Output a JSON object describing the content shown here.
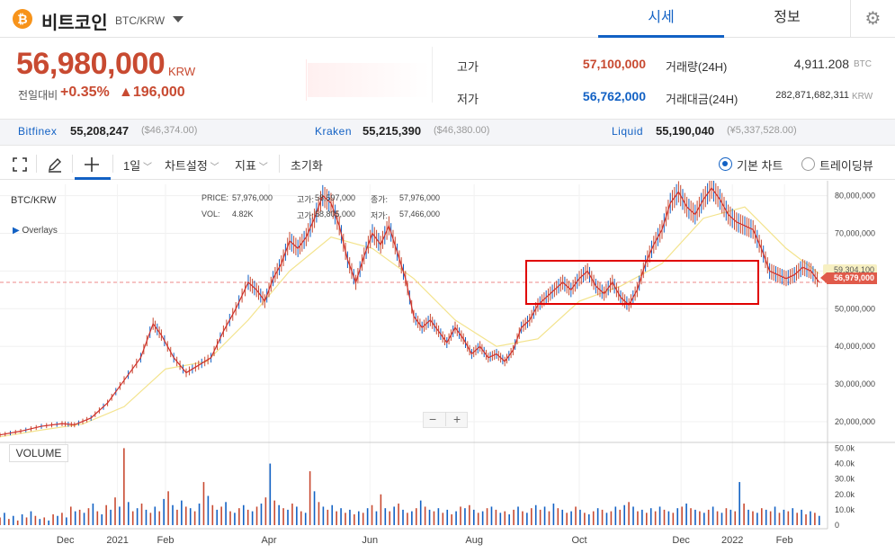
{
  "header": {
    "coin_icon": "₿",
    "coin_name": "비트코인",
    "pair": "BTC/KRW",
    "tab_price": "시세",
    "tab_info": "정보",
    "gear_icon": "⚙"
  },
  "ticker": {
    "price": "56,980,000",
    "unit": "KRW",
    "change_label": "전일대비",
    "change_pct": "+0.35%",
    "change_amt": "▲196,000"
  },
  "stats": {
    "high_label": "고가",
    "high": "57,100,000",
    "low_label": "저가",
    "low": "56,762,000",
    "vol_label": "거래량(24H)",
    "vol": "4,911.208",
    "vol_unit": "BTC",
    "amt_label": "거래대금(24H)",
    "amt": "282,871,682,311",
    "amt_unit": "KRW"
  },
  "exchanges": [
    {
      "name": "Bitfinex",
      "price": "55,208,247",
      "sub": "($46,374.00)"
    },
    {
      "name": "Kraken",
      "price": "55,215,390",
      "sub": "($46,380.00)"
    },
    {
      "name": "Liquid",
      "price": "55,190,040",
      "sub": "(¥5,337,528.00)"
    }
  ],
  "toolbar": {
    "interval": "1일",
    "chart_settings": "차트설정",
    "indicator": "지표",
    "reset": "초기화",
    "basic_chart": "기본 차트",
    "tradingview": "트레이딩뷰"
  },
  "chart_legend": {
    "symbol": "BTC/KRW",
    "overlays": "Overlays",
    "price_label": "PRICE:",
    "price": "57,976,000",
    "vol_label": "VOL:",
    "vol": "4.82K",
    "high_label": "고가:",
    "high": "58,597,000",
    "low_label": "고가:",
    "low": "58,805,000",
    "close_label": "종가:",
    "close": "57,976,000",
    "lowp_label": "저가:",
    "lowp": "57,466,000",
    "last_price_tag": "56,979,000",
    "ma_tag": "59,304,100",
    "volume_button": "VOLUME",
    "zoom_out": "−",
    "zoom_in": "+"
  },
  "chart_data": {
    "type": "line",
    "title": "",
    "x_ticks": [
      "Dec",
      "2021",
      "Feb",
      "Apr",
      "Jun",
      "Aug",
      "Oct",
      "Dec",
      "2022",
      "Feb"
    ],
    "y_ticks": [
      "80,000,000",
      "70,000,000",
      "60,000,000",
      "50,000,000",
      "40,000,000",
      "30,000,000",
      "20,000,000"
    ],
    "y_ticks_values": [
      80000000,
      70000000,
      60000000,
      50000000,
      40000000,
      30000000,
      20000000
    ],
    "ylim": [
      15000000,
      83000000
    ],
    "volume_ticks": [
      "50.0k",
      "40.0k",
      "30.0k",
      "20.0k",
      "10.0k",
      "0"
    ],
    "volume_ylim": [
      0,
      52000
    ],
    "series": [
      {
        "values": [
          [
            0,
            16.5
          ],
          [
            5,
            17.5
          ],
          [
            10,
            18.8
          ],
          [
            15,
            19.5
          ],
          [
            18,
            19.2
          ],
          [
            22,
            21
          ],
          [
            26,
            25
          ],
          [
            30,
            31
          ],
          [
            34,
            37
          ],
          [
            37,
            46
          ],
          [
            39,
            43
          ],
          [
            42,
            37
          ],
          [
            45,
            33
          ],
          [
            48,
            35
          ],
          [
            51,
            37
          ],
          [
            54,
            44
          ],
          [
            57,
            50
          ],
          [
            60,
            57
          ],
          [
            62,
            55
          ],
          [
            64,
            52
          ],
          [
            66,
            58
          ],
          [
            68,
            62
          ],
          [
            70,
            68
          ],
          [
            72,
            66
          ],
          [
            74,
            69
          ],
          [
            76,
            74
          ],
          [
            78,
            80
          ],
          [
            80,
            78
          ],
          [
            82,
            72
          ],
          [
            84,
            63
          ],
          [
            86,
            57
          ],
          [
            88,
            64
          ],
          [
            90,
            70
          ],
          [
            92,
            67
          ],
          [
            94,
            72
          ],
          [
            96,
            65
          ],
          [
            98,
            58
          ],
          [
            100,
            48
          ],
          [
            102,
            45
          ],
          [
            104,
            47
          ],
          [
            106,
            44
          ],
          [
            108,
            41
          ],
          [
            110,
            45
          ],
          [
            112,
            42
          ],
          [
            114,
            38
          ],
          [
            116,
            40
          ],
          [
            118,
            37
          ],
          [
            120,
            38
          ],
          [
            122,
            36
          ],
          [
            124,
            39
          ],
          [
            126,
            45
          ],
          [
            128,
            47
          ],
          [
            130,
            51
          ],
          [
            132,
            53
          ],
          [
            134,
            55
          ],
          [
            136,
            57
          ],
          [
            138,
            55
          ],
          [
            140,
            58
          ],
          [
            142,
            60
          ],
          [
            144,
            56
          ],
          [
            146,
            54
          ],
          [
            148,
            57
          ],
          [
            150,
            53
          ],
          [
            152,
            51
          ],
          [
            154,
            55
          ],
          [
            156,
            62
          ],
          [
            158,
            67
          ],
          [
            160,
            71
          ],
          [
            162,
            78
          ],
          [
            164,
            81
          ],
          [
            166,
            77
          ],
          [
            168,
            75
          ],
          [
            170,
            79
          ],
          [
            172,
            82
          ],
          [
            174,
            79
          ],
          [
            176,
            75
          ],
          [
            178,
            73
          ],
          [
            180,
            72
          ],
          [
            182,
            71
          ],
          [
            184,
            66
          ],
          [
            186,
            60
          ],
          [
            188,
            59
          ],
          [
            190,
            58
          ],
          [
            192,
            59
          ],
          [
            194,
            61
          ],
          [
            196,
            60
          ],
          [
            198,
            57
          ]
        ]
      },
      {
        "values": [
          [
            0,
            16
          ],
          [
            10,
            17.8
          ],
          [
            20,
            19.4
          ],
          [
            30,
            24
          ],
          [
            40,
            34
          ],
          [
            50,
            36
          ],
          [
            60,
            47
          ],
          [
            70,
            60
          ],
          [
            80,
            69
          ],
          [
            90,
            66
          ],
          [
            100,
            58
          ],
          [
            110,
            47
          ],
          [
            120,
            40
          ],
          [
            130,
            42
          ],
          [
            140,
            52
          ],
          [
            150,
            56
          ],
          [
            160,
            62
          ],
          [
            170,
            74
          ],
          [
            180,
            77
          ],
          [
            190,
            66
          ],
          [
            198,
            59.3
          ]
        ]
      }
    ],
    "x_domain": [
      0,
      200
    ],
    "volume": [
      5,
      8,
      4,
      6,
      3,
      7,
      5,
      9,
      6,
      4,
      5,
      3,
      7,
      6,
      8,
      5,
      12,
      9,
      10,
      8,
      11,
      14,
      9,
      7,
      13,
      10,
      18,
      12,
      50,
      15,
      9,
      11,
      14,
      10,
      8,
      12,
      9,
      17,
      22,
      13,
      10,
      16,
      12,
      11,
      9,
      14,
      28,
      19,
      13,
      10,
      12,
      15,
      9,
      8,
      11,
      13,
      10,
      9,
      12,
      14,
      18,
      40,
      16,
      13,
      11,
      10,
      14,
      12,
      9,
      8,
      35,
      22,
      15,
      12,
      10,
      13,
      9,
      11,
      8,
      10,
      7,
      9,
      8,
      11,
      13,
      9,
      20,
      11,
      9,
      12,
      14,
      10,
      8,
      9,
      11,
      16,
      12,
      10,
      9,
      11,
      8,
      10,
      7,
      9,
      12,
      11,
      13,
      10,
      8,
      9,
      11,
      12,
      10,
      8,
      9,
      7,
      10,
      12,
      9,
      8,
      11,
      13,
      10,
      12,
      9,
      14,
      11,
      10,
      8,
      9,
      12,
      10,
      8,
      7,
      9,
      11,
      10,
      8,
      9,
      12,
      10,
      13,
      15,
      12,
      9,
      10,
      8,
      11,
      9,
      12,
      10,
      9,
      8,
      11,
      12,
      14,
      11,
      10,
      9,
      8,
      10,
      12,
      9,
      8,
      11,
      10,
      9,
      28,
      14,
      10,
      9,
      8,
      11,
      10,
      9,
      12,
      8,
      10,
      9,
      11,
      8,
      10,
      7,
      9,
      8,
      6
    ]
  },
  "colors": {
    "up": "#c84a31",
    "down": "#1261c4",
    "accent": "#1261c4",
    "ma": "#f3e38c",
    "highlight_box": "#e00000"
  }
}
